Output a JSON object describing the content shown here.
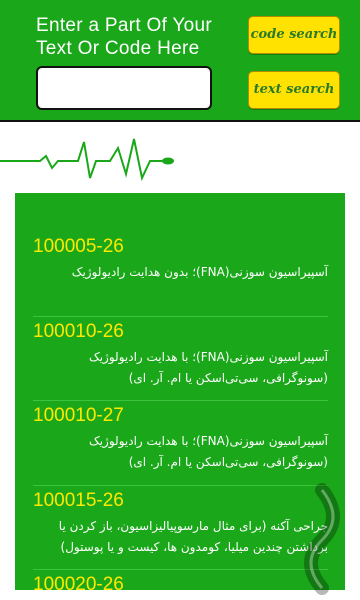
{
  "header": {
    "title": "Enter a Part Of Your Text Or Code Here",
    "search_value": "",
    "code_search_label": "code search",
    "text_search_label": "text search"
  },
  "results": [
    {
      "code": "100005-26",
      "description": "آسپیراسیون سوزنی(FNA)؛ بدون هدایت رادیولوژیک"
    },
    {
      "code": "100010-26",
      "description": "آسپیراسیون سوزنی(FNA)؛ با هدایت رادیولوژیک (سونوگرافی، سی‌تی‌اسکن یا ام. آر. ای)"
    },
    {
      "code": "100010-27",
      "description": "آسپیراسیون سوزنی(FNA)؛ با هدایت رادیولوژیک (سونوگرافی، سی‌تی‌اسکن یا ام. آر. ای)"
    },
    {
      "code": "100015-26",
      "description": "جراحی آکنه (برای مثال مارسوپیالیزاسیون، باز کردن یا برداشتن چندین میلیا، کومدون ها، کیست و یا پوستول)"
    },
    {
      "code": "100020-26",
      "description": ""
    }
  ],
  "icons": {
    "pulse": "heartbeat-line-icon",
    "share": "share-icon"
  },
  "colors": {
    "green": "#1aa81a",
    "yellow": "#ffe200",
    "code_text": "#ffe800"
  }
}
